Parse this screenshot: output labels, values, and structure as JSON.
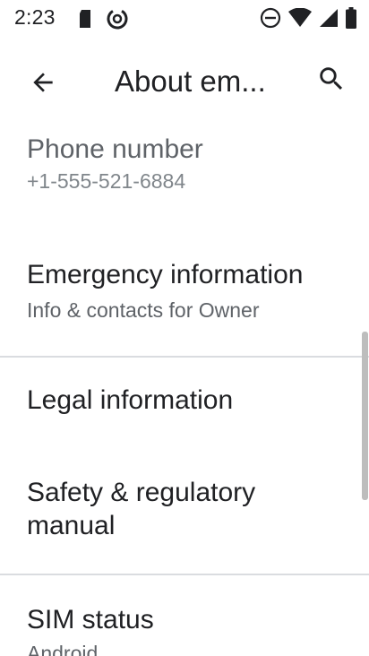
{
  "status_bar": {
    "time": "2:23",
    "left_icons": [
      "sd-card-icon",
      "data-saver-icon"
    ],
    "right_icons": [
      "do-not-disturb-icon",
      "wifi-icon",
      "cellular-signal-icon",
      "battery-icon"
    ]
  },
  "app_bar": {
    "title": "About em...",
    "back_icon": "back-arrow-icon",
    "search_icon": "search-icon"
  },
  "items": [
    {
      "title": "Phone number",
      "subtitle": "+1-555-521-6884"
    },
    {
      "title": "Emergency information",
      "subtitle": "Info & contacts for Owner"
    },
    {
      "title": "Legal information"
    },
    {
      "title": "Safety & regulatory",
      "title_line2": "manual"
    },
    {
      "title": "SIM status",
      "subtitle": "Android"
    }
  ],
  "colors": {
    "text_primary": "#202124",
    "text_secondary": "#5f6368",
    "divider": "#dadce0",
    "background": "#ffffff"
  }
}
